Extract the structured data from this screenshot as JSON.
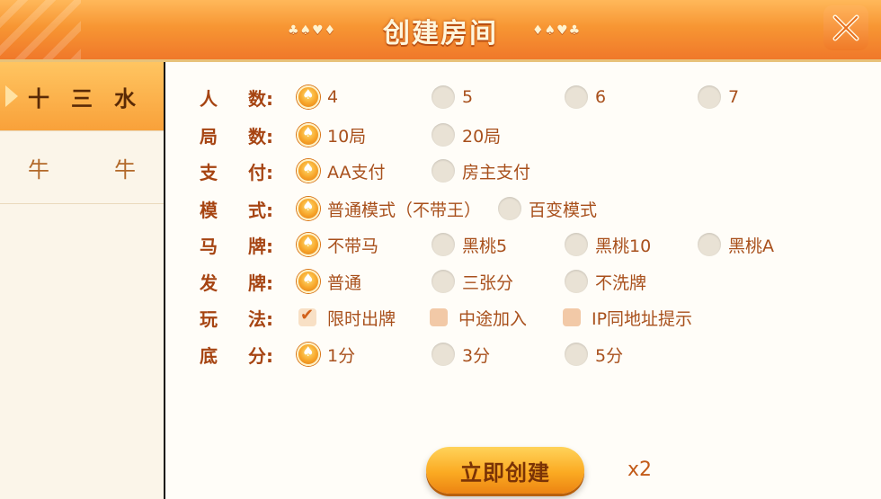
{
  "header": {
    "title": "创建房间",
    "suits_left": "♣♠♥♦",
    "suits_right": "♦♠♥♣"
  },
  "sidebar": {
    "items": [
      {
        "label_a": "十",
        "label_b": "三",
        "label_c": "水"
      },
      {
        "label_a": "牛",
        "label_b": "",
        "label_c": "牛"
      }
    ]
  },
  "rows": [
    {
      "label_a": "人",
      "label_b": "数:",
      "options": [
        "4",
        "5",
        "6",
        "7"
      ]
    },
    {
      "label_a": "局",
      "label_b": "数:",
      "options": [
        "10局",
        "20局"
      ]
    },
    {
      "label_a": "支",
      "label_b": "付:",
      "options": [
        "AA支付",
        "房主支付"
      ]
    },
    {
      "label_a": "模",
      "label_b": "式:",
      "options": [
        "普通模式（不带王）",
        "百变模式"
      ]
    },
    {
      "label_a": "马",
      "label_b": "牌:",
      "options": [
        "不带马",
        "黑桃5",
        "黑桃10",
        "黑桃A"
      ]
    },
    {
      "label_a": "发",
      "label_b": "牌:",
      "options": [
        "普通",
        "三张分",
        "不洗牌"
      ]
    },
    {
      "label_a": "玩",
      "label_b": "法:",
      "options": [
        "限时出牌",
        "中途加入",
        "IP同地址提示"
      ]
    },
    {
      "label_a": "底",
      "label_b": "分:",
      "options": [
        "1分",
        "3分",
        "5分"
      ]
    }
  ],
  "footer": {
    "create_label": "立即创建",
    "cost": "x2"
  },
  "colors": {
    "accent": "#f79633",
    "label": "#a64412",
    "option_text": "#a8501c"
  }
}
